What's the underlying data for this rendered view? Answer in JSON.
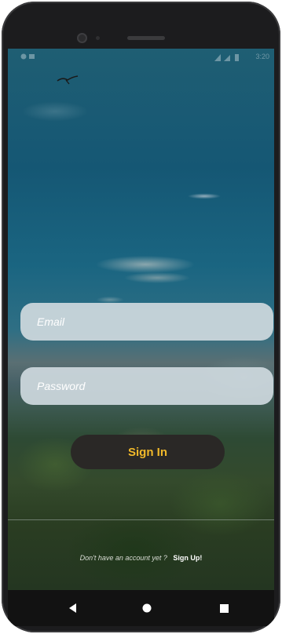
{
  "status_bar": {
    "time": "3:20",
    "icons": [
      "signal-icon",
      "wifi-icon",
      "battery-icon"
    ]
  },
  "login": {
    "email_placeholder": "Email",
    "password_placeholder": "Password",
    "sign_in_label": "Sign In"
  },
  "signup": {
    "prompt": "Don't have an account yet ?",
    "link_label": "Sign Up!"
  },
  "nav": {
    "buttons": [
      "back-icon",
      "home-icon",
      "recents-icon"
    ]
  },
  "colors": {
    "button_background": "#2a2826",
    "button_text": "#f1b92a",
    "input_background": "#cdd8de"
  }
}
